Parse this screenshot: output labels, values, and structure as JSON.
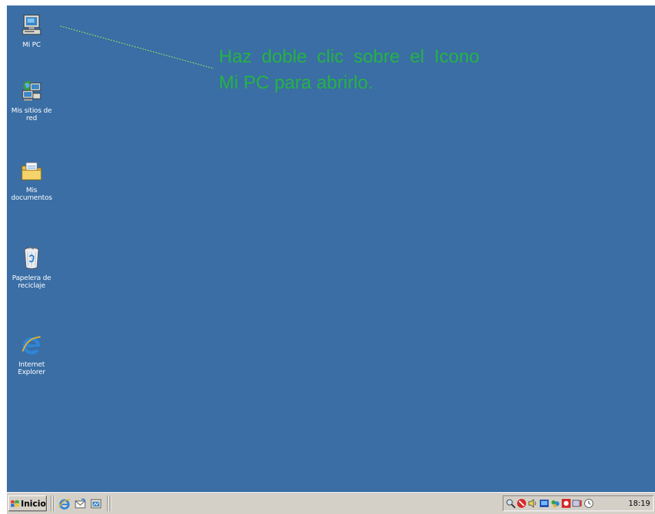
{
  "desktop": {
    "background": "#3a6ea5",
    "icons": [
      {
        "label": "Mi PC",
        "icon": "my-computer-icon"
      },
      {
        "label": "Mis sitios de\nred",
        "icon": "network-places-icon"
      },
      {
        "label": "Mis\ndocumentos",
        "icon": "my-documents-icon"
      },
      {
        "label": "Papelera de\nreciclaje",
        "icon": "recycle-bin-icon"
      },
      {
        "label": "Internet\nExplorer",
        "icon": "internet-explorer-icon"
      }
    ]
  },
  "annotation": {
    "text": "Haz doble clic sobre el Icono Mi PC para abrirlo.",
    "color": "#22c032"
  },
  "taskbar": {
    "start_label": "Inicio",
    "quick_launch": [
      "internet-explorer-icon",
      "outlook-express-icon",
      "show-desktop-icon"
    ],
    "tray_icons": [
      "search-icon",
      "antivirus-icon",
      "volume-icon",
      "network-icon",
      "messenger-icon",
      "security-icon",
      "keyboard-icon",
      "clock-icon"
    ],
    "clock": "18:19"
  }
}
